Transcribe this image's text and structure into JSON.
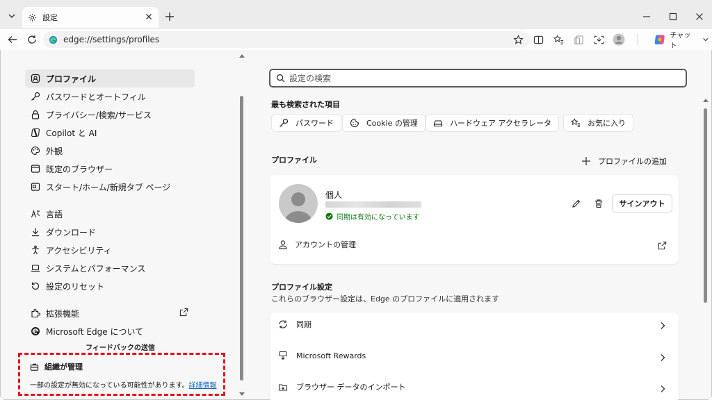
{
  "tab": {
    "title": "設定"
  },
  "address": {
    "url": "edge://settings/profiles"
  },
  "copilot": {
    "label": "チャット"
  },
  "sidebar": {
    "items": [
      {
        "label": "プロファイル",
        "icon": "profile-icon"
      },
      {
        "label": "パスワードとオートフィル",
        "icon": "key-icon"
      },
      {
        "label": "プライバシー/検索/サービス",
        "icon": "lock-icon"
      },
      {
        "label": "Copilot と AI",
        "icon": "copilot-icon"
      },
      {
        "label": "外観",
        "icon": "palette-icon"
      },
      {
        "label": "既定のブラウザー",
        "icon": "browser-icon"
      },
      {
        "label": "スタート/ホーム/新規タブ ページ",
        "icon": "home-icon"
      },
      {
        "label": "言語",
        "icon": "language-icon"
      },
      {
        "label": "ダウンロード",
        "icon": "download-icon"
      },
      {
        "label": "アクセシビリティ",
        "icon": "accessibility-icon"
      },
      {
        "label": "システムとパフォーマンス",
        "icon": "laptop-icon"
      },
      {
        "label": "設定のリセット",
        "icon": "reset-icon"
      },
      {
        "label": "拡張機能",
        "icon": "extensions-icon"
      },
      {
        "label": "Microsoft Edge について",
        "icon": "edge-icon"
      }
    ],
    "feedback": "フィードバックの送信",
    "managed_title": "組織が管理",
    "managed_msg": "一部の設定が無効になっている可能性があります。",
    "managed_link": "詳細情報"
  },
  "search": {
    "placeholder": "設定の検索"
  },
  "most_searched": {
    "heading": "最も検索された項目",
    "chips": [
      {
        "label": "パスワード",
        "icon": "key-icon"
      },
      {
        "label": "Cookie の管理",
        "icon": "cookie-icon"
      },
      {
        "label": "ハードウェア アクセラレータ",
        "icon": "hardware-icon"
      },
      {
        "label": "お気に入り",
        "icon": "favorites-icon"
      }
    ]
  },
  "profiles": {
    "heading": "プロファイル",
    "add_label": "プロファイルの追加",
    "name": "個人",
    "sync_status": "同期は有効になっています",
    "signout": "サインアウト",
    "manage_account": "アカウントの管理"
  },
  "profile_settings": {
    "heading": "プロファイル設定",
    "subtitle": "これらのブラウザー設定は、Edge のプロファイルに適用されます",
    "rows": [
      {
        "label": "同期",
        "icon": "sync-icon"
      },
      {
        "label": "Microsoft Rewards",
        "icon": "rewards-icon"
      },
      {
        "label": "ブラウザー データのインポート",
        "icon": "import-icon"
      }
    ]
  },
  "colors": {
    "accent": "#0f6cbd",
    "managed_border": "#e8101a",
    "sync_green": "#0e7a0d"
  }
}
